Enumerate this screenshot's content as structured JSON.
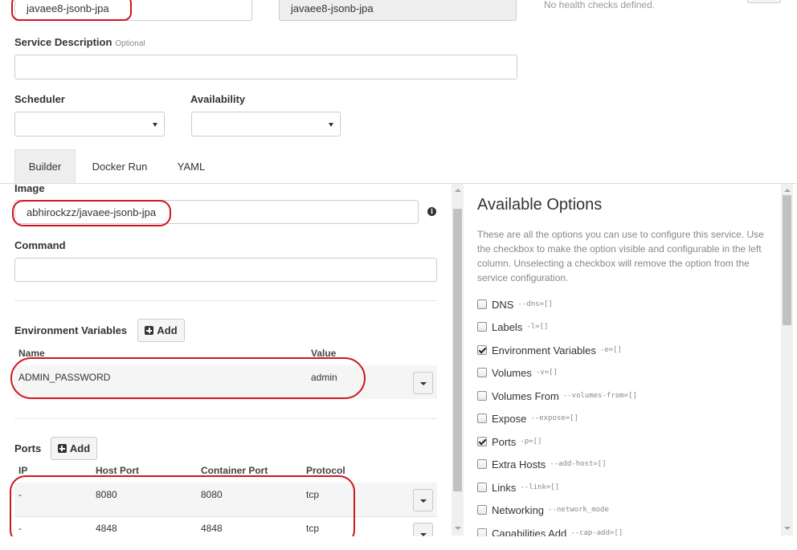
{
  "service": {
    "name_value": "javaee8-jsonb-jpa",
    "name_readonly_value": "javaee8-jsonb-jpa",
    "description_label": "Service Description",
    "description_optional": "Optional",
    "description_value": "",
    "scheduler_label": "Scheduler",
    "scheduler_value": "",
    "availability_label": "Availability",
    "availability_value": ""
  },
  "health": {
    "empty_text": "No health checks defined."
  },
  "tabs": [
    {
      "label": "Builder",
      "active": true
    },
    {
      "label": "Docker Run",
      "active": false
    },
    {
      "label": "YAML",
      "active": false
    }
  ],
  "builder": {
    "image_label": "Image",
    "image_value": "abhirockzz/javaee-jsonb-jpa",
    "info_icon_glyph": "i",
    "command_label": "Command",
    "command_value": "",
    "env": {
      "label": "Environment Variables",
      "add_label": "Add",
      "headers": {
        "name": "Name",
        "value": "Value"
      },
      "rows": [
        {
          "name": "ADMIN_PASSWORD",
          "value": "admin"
        }
      ]
    },
    "ports": {
      "label": "Ports",
      "add_label": "Add",
      "headers": {
        "ip": "IP",
        "host": "Host Port",
        "container": "Container Port",
        "protocol": "Protocol"
      },
      "rows": [
        {
          "ip": "-",
          "host": "8080",
          "container": "8080",
          "protocol": "tcp"
        },
        {
          "ip": "-",
          "host": "4848",
          "container": "4848",
          "protocol": "tcp"
        }
      ]
    }
  },
  "options": {
    "title": "Available Options",
    "description": "These are all the options you can use to configure this service. Use the checkbox to make the option visible and configurable in the left column. Unselecting a checkbox will remove the option from the service configuration.",
    "items": [
      {
        "name": "DNS",
        "flag": "--dns=[]",
        "checked": false
      },
      {
        "name": "Labels",
        "flag": "-l=[]",
        "checked": false
      },
      {
        "name": "Environment Variables",
        "flag": "-e=[]",
        "checked": true
      },
      {
        "name": "Volumes",
        "flag": "-v=[]",
        "checked": false
      },
      {
        "name": "Volumes From",
        "flag": "--volumes-from=[]",
        "checked": false
      },
      {
        "name": "Expose",
        "flag": "--expose=[]",
        "checked": false
      },
      {
        "name": "Ports",
        "flag": "-p=[]",
        "checked": true
      },
      {
        "name": "Extra Hosts",
        "flag": "--add-host=[]",
        "checked": false
      },
      {
        "name": "Links",
        "flag": "--link=[]",
        "checked": false
      },
      {
        "name": "Networking",
        "flag": "--network_mode",
        "checked": false
      },
      {
        "name": "Capabilities Add",
        "flag": "--cap-add=[]",
        "checked": false
      }
    ]
  },
  "colors": {
    "annotation_red": "#d0161f",
    "tab_active_bg": "#eeeeee",
    "row_bg": "#f5f5f5"
  }
}
